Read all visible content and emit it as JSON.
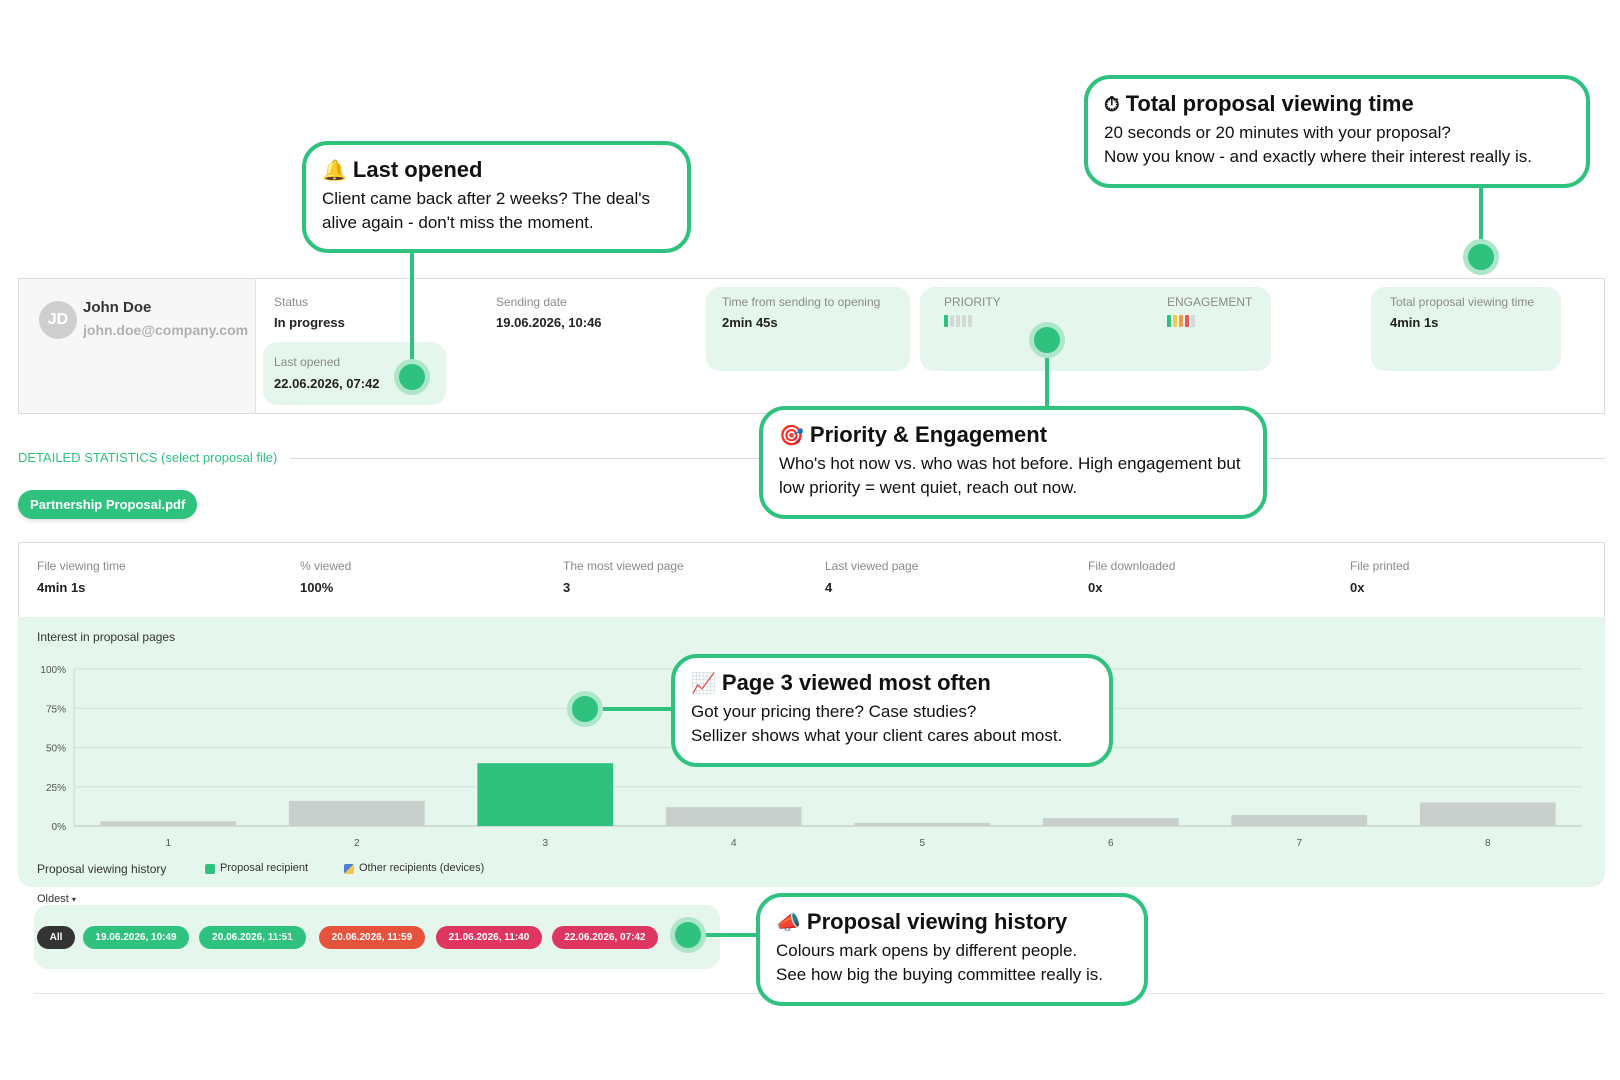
{
  "contact": {
    "initials": "JD",
    "name": "John Doe",
    "email": "john.doe@company.com"
  },
  "summary": {
    "status_label": "Status",
    "status_value": "In progress",
    "last_opened_label": "Last opened",
    "last_opened_value": "22.06.2026, 07:42",
    "sending_date_label": "Sending date",
    "sending_date_value": "19.06.2026, 10:46",
    "time_to_open_label": "Time from sending to opening",
    "time_to_open_value": "2min 45s",
    "priority_label": "PRIORITY",
    "priority_level": 1,
    "engagement_label": "ENGAGEMENT",
    "engagement_level": 4,
    "total_time_label": "Total proposal viewing time",
    "total_time_value": "4min 1s"
  },
  "detailed": {
    "title": "DETAILED STATISTICS (select proposal file)",
    "file_name": "Partnership Proposal.pdf"
  },
  "file_stats": [
    {
      "label": "File viewing time",
      "value": "4min 1s"
    },
    {
      "label": "% viewed",
      "value": "100%"
    },
    {
      "label": "The most viewed page",
      "value": "3"
    },
    {
      "label": "Last viewed page",
      "value": "4"
    },
    {
      "label": "File downloaded",
      "value": "0x"
    },
    {
      "label": "File printed",
      "value": "0x"
    }
  ],
  "chart_data": {
    "type": "bar",
    "title": "Interest in proposal pages",
    "categories": [
      "1",
      "2",
      "3",
      "4",
      "5",
      "6",
      "7",
      "8"
    ],
    "values": [
      3,
      16,
      40,
      12,
      2,
      5,
      7,
      15
    ],
    "highlight_index": 2,
    "y_ticks": [
      "0%",
      "25%",
      "50%",
      "75%",
      "100%"
    ],
    "ylim": [
      0,
      100
    ],
    "grid": true,
    "colors": {
      "bar": "#c9cfcd",
      "highlight": "#2ec27e"
    }
  },
  "history": {
    "label": "Proposal viewing history",
    "legend_recipient": "Proposal recipient",
    "legend_other": "Other recipients (devices)",
    "sort_label": "Oldest",
    "all_label": "All",
    "sessions": [
      {
        "label": "19.06.2026, 10:49",
        "color": "#2ec27e"
      },
      {
        "label": "20.06.2026, 11:51",
        "color": "#2ec27e"
      },
      {
        "label": "20.06.2026, 11:59",
        "color": "#e5533c"
      },
      {
        "label": "21.06.2026, 11:40",
        "color": "#df3661"
      },
      {
        "label": "22.06.2026, 07:42",
        "color": "#df3661"
      }
    ]
  },
  "callouts": {
    "last_opened": {
      "icon": "bell-icon",
      "emoji": "🔔",
      "title": "Last opened",
      "body": "Client came back after 2 weeks? The deal's alive again - don't miss the moment."
    },
    "total_time": {
      "icon": "stopwatch-icon",
      "emoji": "⏱",
      "title": "Total proposal viewing time",
      "body_line1": "20 seconds or 20 minutes with your proposal?",
      "body_line2": "Now you know - and exactly where their interest really is."
    },
    "priority": {
      "icon": "target-icon",
      "emoji": "🎯",
      "title": "Priority & Engagement",
      "body": "Who's hot now vs. who was hot before. High engagement but low priority = went quiet, reach out now."
    },
    "page3": {
      "icon": "chart-increasing-icon",
      "emoji": "📈",
      "title": "Page 3 viewed most often",
      "body_line1": "Got your pricing there? Case studies?",
      "body_line2": "Sellizer shows what your client cares about most."
    },
    "history": {
      "icon": "megaphone-icon",
      "emoji": "📣",
      "title": "Proposal viewing history",
      "body_line1": "Colours mark opens by different people.",
      "body_line2": "See how big the buying committee really is."
    }
  },
  "colors": {
    "accent": "#2ec27e",
    "mint_panel": "#e5f6ec",
    "orange": "#e5533c",
    "crimson": "#df3661"
  }
}
